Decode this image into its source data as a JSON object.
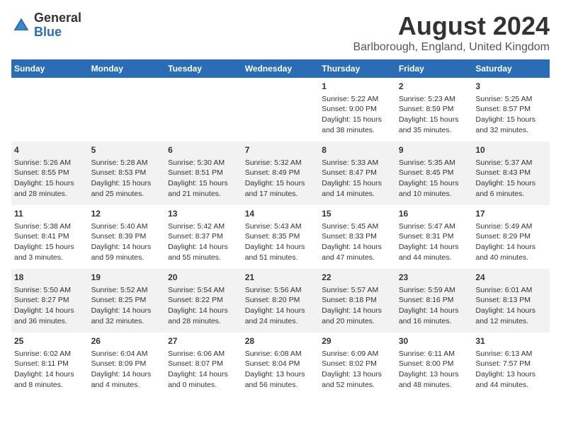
{
  "header": {
    "logo_line1": "General",
    "logo_line2": "Blue",
    "main_title": "August 2024",
    "subtitle": "Barlborough, England, United Kingdom"
  },
  "days_of_week": [
    "Sunday",
    "Monday",
    "Tuesday",
    "Wednesday",
    "Thursday",
    "Friday",
    "Saturday"
  ],
  "weeks": [
    {
      "cells": [
        {
          "day": "",
          "content": ""
        },
        {
          "day": "",
          "content": ""
        },
        {
          "day": "",
          "content": ""
        },
        {
          "day": "",
          "content": ""
        },
        {
          "day": "1",
          "content": "Sunrise: 5:22 AM\nSunset: 9:00 PM\nDaylight: 15 hours\nand 38 minutes."
        },
        {
          "day": "2",
          "content": "Sunrise: 5:23 AM\nSunset: 8:59 PM\nDaylight: 15 hours\nand 35 minutes."
        },
        {
          "day": "3",
          "content": "Sunrise: 5:25 AM\nSunset: 8:57 PM\nDaylight: 15 hours\nand 32 minutes."
        }
      ]
    },
    {
      "cells": [
        {
          "day": "4",
          "content": "Sunrise: 5:26 AM\nSunset: 8:55 PM\nDaylight: 15 hours\nand 28 minutes."
        },
        {
          "day": "5",
          "content": "Sunrise: 5:28 AM\nSunset: 8:53 PM\nDaylight: 15 hours\nand 25 minutes."
        },
        {
          "day": "6",
          "content": "Sunrise: 5:30 AM\nSunset: 8:51 PM\nDaylight: 15 hours\nand 21 minutes."
        },
        {
          "day": "7",
          "content": "Sunrise: 5:32 AM\nSunset: 8:49 PM\nDaylight: 15 hours\nand 17 minutes."
        },
        {
          "day": "8",
          "content": "Sunrise: 5:33 AM\nSunset: 8:47 PM\nDaylight: 15 hours\nand 14 minutes."
        },
        {
          "day": "9",
          "content": "Sunrise: 5:35 AM\nSunset: 8:45 PM\nDaylight: 15 hours\nand 10 minutes."
        },
        {
          "day": "10",
          "content": "Sunrise: 5:37 AM\nSunset: 8:43 PM\nDaylight: 15 hours\nand 6 minutes."
        }
      ]
    },
    {
      "cells": [
        {
          "day": "11",
          "content": "Sunrise: 5:38 AM\nSunset: 8:41 PM\nDaylight: 15 hours\nand 3 minutes."
        },
        {
          "day": "12",
          "content": "Sunrise: 5:40 AM\nSunset: 8:39 PM\nDaylight: 14 hours\nand 59 minutes."
        },
        {
          "day": "13",
          "content": "Sunrise: 5:42 AM\nSunset: 8:37 PM\nDaylight: 14 hours\nand 55 minutes."
        },
        {
          "day": "14",
          "content": "Sunrise: 5:43 AM\nSunset: 8:35 PM\nDaylight: 14 hours\nand 51 minutes."
        },
        {
          "day": "15",
          "content": "Sunrise: 5:45 AM\nSunset: 8:33 PM\nDaylight: 14 hours\nand 47 minutes."
        },
        {
          "day": "16",
          "content": "Sunrise: 5:47 AM\nSunset: 8:31 PM\nDaylight: 14 hours\nand 44 minutes."
        },
        {
          "day": "17",
          "content": "Sunrise: 5:49 AM\nSunset: 8:29 PM\nDaylight: 14 hours\nand 40 minutes."
        }
      ]
    },
    {
      "cells": [
        {
          "day": "18",
          "content": "Sunrise: 5:50 AM\nSunset: 8:27 PM\nDaylight: 14 hours\nand 36 minutes."
        },
        {
          "day": "19",
          "content": "Sunrise: 5:52 AM\nSunset: 8:25 PM\nDaylight: 14 hours\nand 32 minutes."
        },
        {
          "day": "20",
          "content": "Sunrise: 5:54 AM\nSunset: 8:22 PM\nDaylight: 14 hours\nand 28 minutes."
        },
        {
          "day": "21",
          "content": "Sunrise: 5:56 AM\nSunset: 8:20 PM\nDaylight: 14 hours\nand 24 minutes."
        },
        {
          "day": "22",
          "content": "Sunrise: 5:57 AM\nSunset: 8:18 PM\nDaylight: 14 hours\nand 20 minutes."
        },
        {
          "day": "23",
          "content": "Sunrise: 5:59 AM\nSunset: 8:16 PM\nDaylight: 14 hours\nand 16 minutes."
        },
        {
          "day": "24",
          "content": "Sunrise: 6:01 AM\nSunset: 8:13 PM\nDaylight: 14 hours\nand 12 minutes."
        }
      ]
    },
    {
      "cells": [
        {
          "day": "25",
          "content": "Sunrise: 6:02 AM\nSunset: 8:11 PM\nDaylight: 14 hours\nand 8 minutes."
        },
        {
          "day": "26",
          "content": "Sunrise: 6:04 AM\nSunset: 8:09 PM\nDaylight: 14 hours\nand 4 minutes."
        },
        {
          "day": "27",
          "content": "Sunrise: 6:06 AM\nSunset: 8:07 PM\nDaylight: 14 hours\nand 0 minutes."
        },
        {
          "day": "28",
          "content": "Sunrise: 6:08 AM\nSunset: 8:04 PM\nDaylight: 13 hours\nand 56 minutes."
        },
        {
          "day": "29",
          "content": "Sunrise: 6:09 AM\nSunset: 8:02 PM\nDaylight: 13 hours\nand 52 minutes."
        },
        {
          "day": "30",
          "content": "Sunrise: 6:11 AM\nSunset: 8:00 PM\nDaylight: 13 hours\nand 48 minutes."
        },
        {
          "day": "31",
          "content": "Sunrise: 6:13 AM\nSunset: 7:57 PM\nDaylight: 13 hours\nand 44 minutes."
        }
      ]
    }
  ]
}
